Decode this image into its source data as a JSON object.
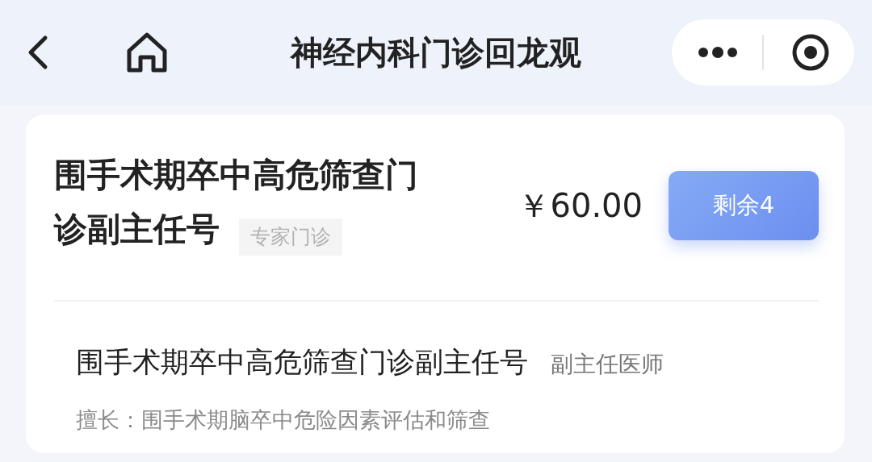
{
  "nav": {
    "title": "神经内科门诊回龙观"
  },
  "clinic": {
    "title_lines": [
      "围手术期卒中高危筛查门",
      "诊副主任号"
    ],
    "tag": "专家门诊",
    "price": "￥60.00",
    "button": "剩余4"
  },
  "doctor": {
    "name": "围手术期卒中高危筛查门诊副主任号",
    "rank": "副主任医师",
    "specialty": "擅长：围手术期脑卒中危险因素评估和筛查"
  }
}
